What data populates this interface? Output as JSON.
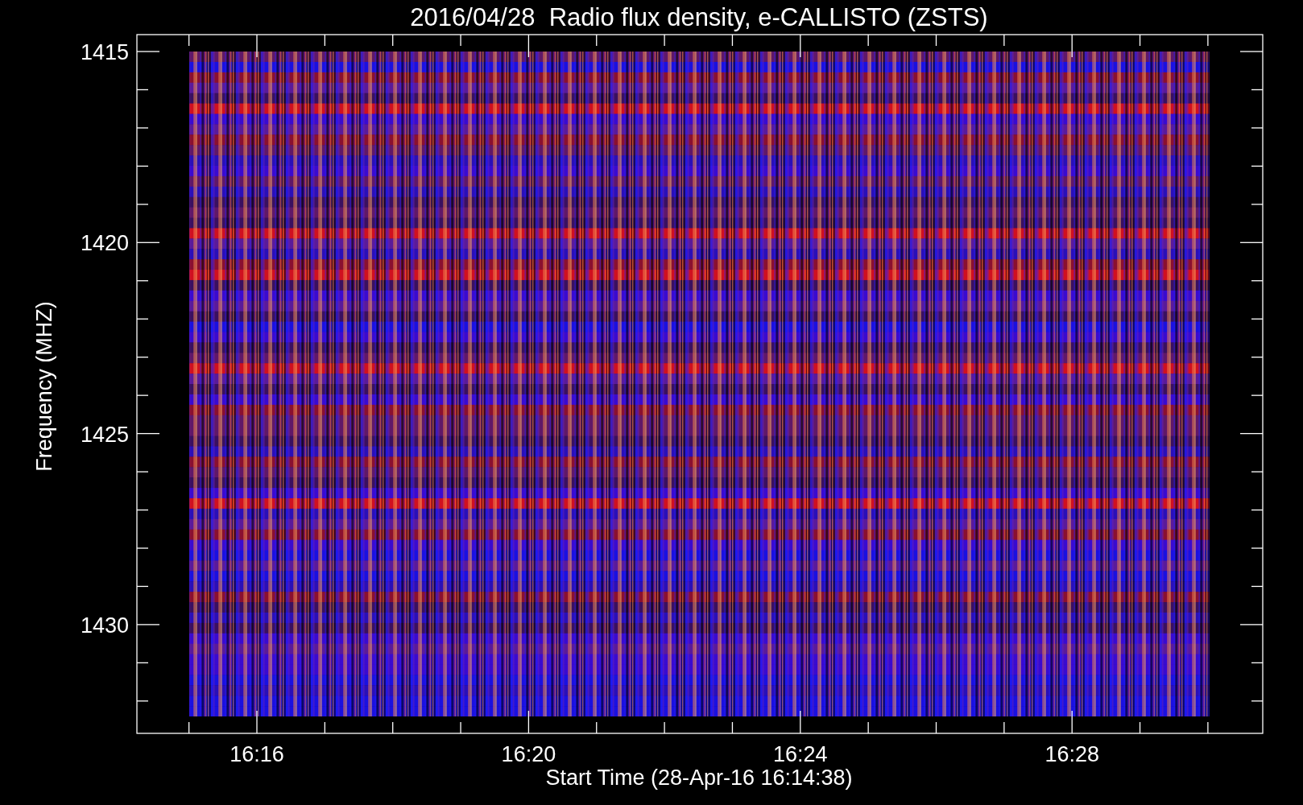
{
  "title": "2016/04/28  Radio flux density, e-CALLISTO (ZSTS)",
  "y_axis": {
    "label": "Frequency (MHZ)",
    "ticks": [
      "1415",
      "1420",
      "1425",
      "1430"
    ]
  },
  "x_axis": {
    "label": "Start Time (28-Apr-16 16:14:38)",
    "ticks": [
      "16:16",
      "16:20",
      "16:24",
      "16:28"
    ]
  }
}
